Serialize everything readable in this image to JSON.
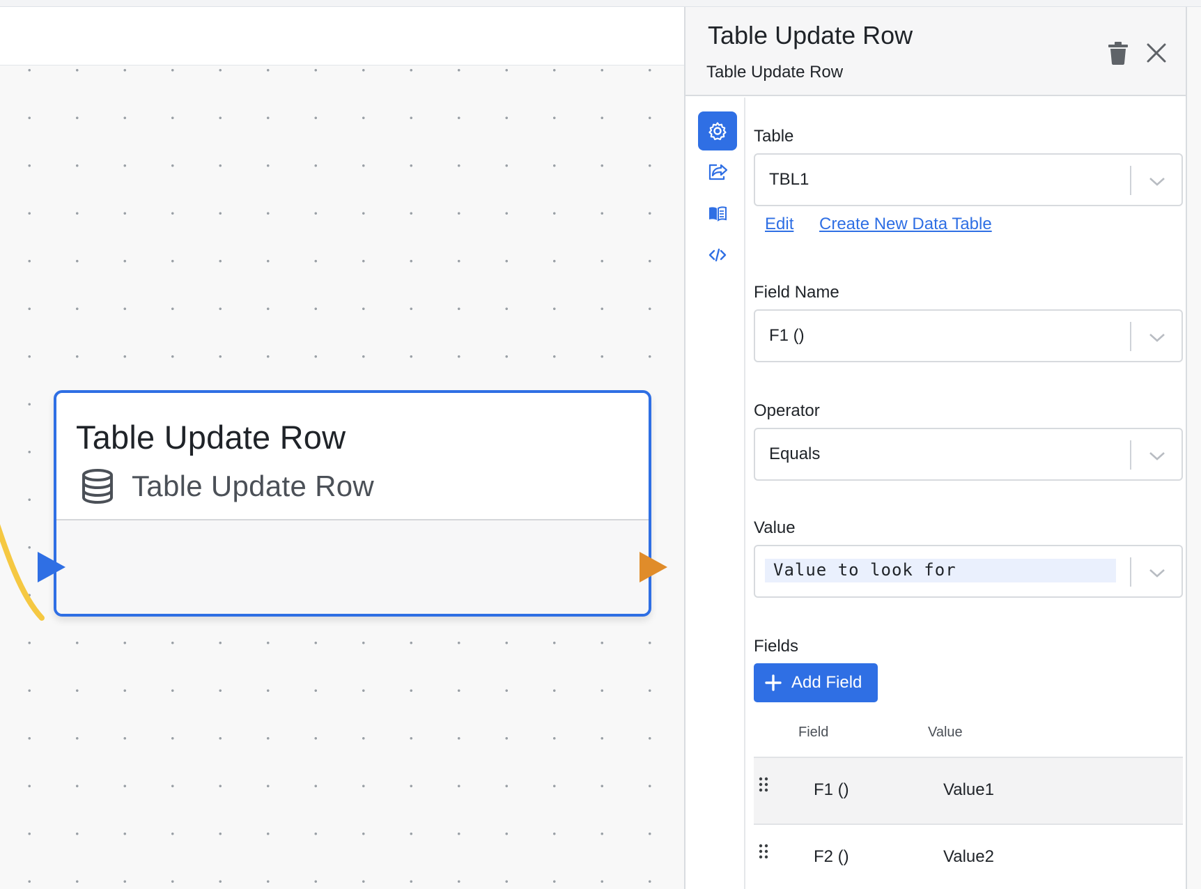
{
  "node": {
    "title": "Table Update Row",
    "subtitle": "Table Update Row",
    "icon": "database-icon",
    "border_color": "#2f6fe4",
    "input_port_color": "#2f6fe4",
    "output_port_color": "#e08c2a",
    "connector_color": "#f5c842"
  },
  "panel": {
    "title": "Table Update Row",
    "subtitle": "Table Update Row",
    "side_tabs": [
      "gear-icon",
      "share-icon",
      "book-icon",
      "code-icon"
    ],
    "table": {
      "label": "Table",
      "value": "TBL1",
      "links": {
        "edit": "Edit",
        "create": "Create New Data Table"
      }
    },
    "field_name": {
      "label": "Field Name",
      "value": "F1 ()"
    },
    "operator": {
      "label": "Operator",
      "value": "Equals"
    },
    "value": {
      "label": "Value",
      "value": "Value to look for"
    },
    "fields": {
      "label": "Fields",
      "add_button": "Add Field",
      "columns": {
        "field": "Field",
        "value": "Value"
      },
      "rows": [
        {
          "field": "F1 ()",
          "value": "Value1"
        },
        {
          "field": "F2 ()",
          "value": "Value2"
        }
      ]
    },
    "accent_color": "#2f6fe4"
  }
}
